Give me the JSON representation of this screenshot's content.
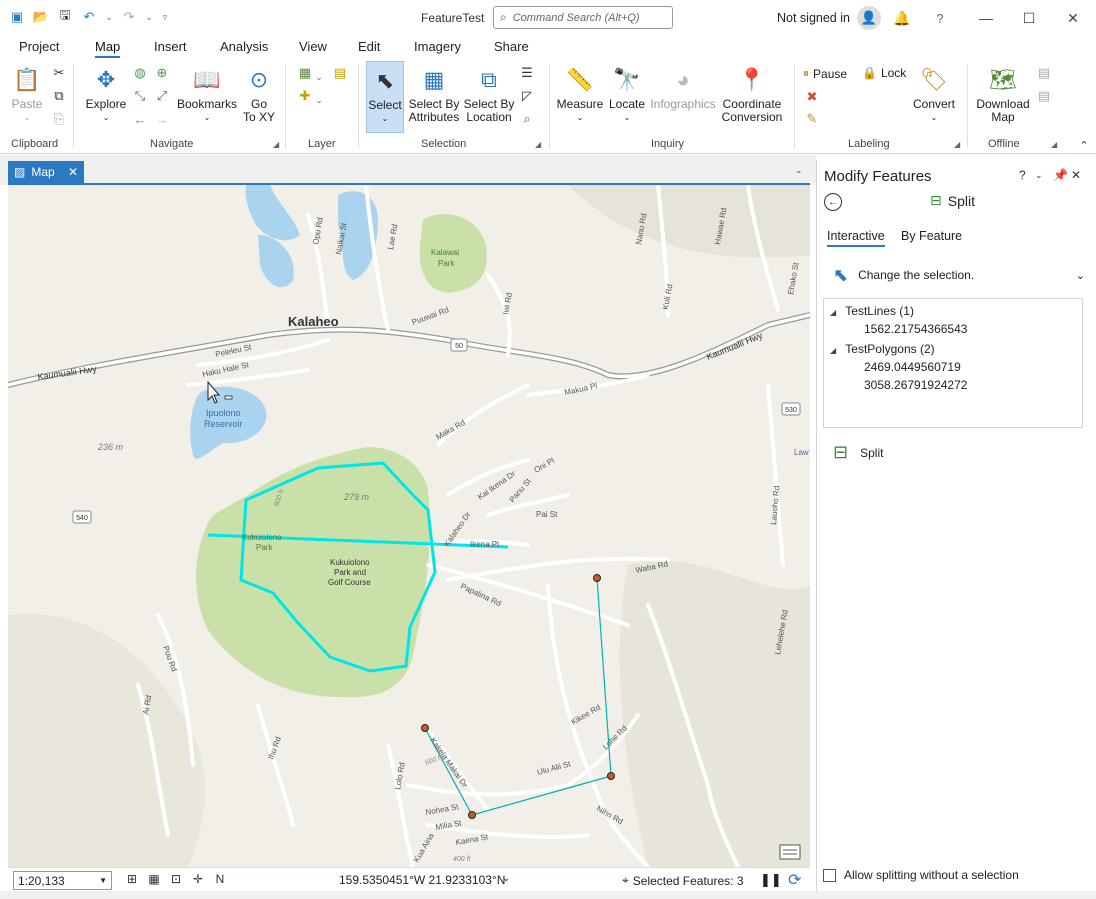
{
  "title_bar": {
    "app_title": "FeatureTest",
    "search_placeholder": "Command Search (Alt+Q)",
    "signed_in": "Not signed in"
  },
  "ribbon_tabs": [
    "Project",
    "Map",
    "Insert",
    "Analysis",
    "View",
    "Edit",
    "Imagery",
    "Share"
  ],
  "ribbon": {
    "clipboard": {
      "paste": "Paste",
      "group": "Clipboard"
    },
    "navigate": {
      "explore": "Explore",
      "bookmarks": "Bookmarks",
      "goto_1": "Go",
      "goto_2": "To XY",
      "group": "Navigate"
    },
    "layer": {
      "group": "Layer"
    },
    "selection": {
      "select": "Select",
      "by_attr_1": "Select By",
      "by_attr_2": "Attributes",
      "by_loc_1": "Select By",
      "by_loc_2": "Location",
      "group": "Selection"
    },
    "inquiry": {
      "measure": "Measure",
      "locate": "Locate",
      "infographics": "Infographics",
      "coord_1": "Coordinate",
      "coord_2": "Conversion",
      "group": "Inquiry"
    },
    "labeling": {
      "pause": "Pause",
      "lock": "Lock",
      "convert": "Convert",
      "group": "Labeling"
    },
    "offline": {
      "download_1": "Download",
      "download_2": "Map",
      "group": "Offline"
    }
  },
  "map_tab": {
    "label": "Map"
  },
  "map_labels": {
    "town": "Kalaheo",
    "kalawai_1": "Kalawai",
    "kalawai_2": "Park",
    "reservoir_1": "Ipuolono",
    "reservoir_2": "Reservoir",
    "golf_1": "Kukuiolono",
    "golf_2": "Park and",
    "golf_3": "Golf Course",
    "park_left": "Kukuiolono",
    "park_left_2": "Park",
    "elev_236": "236 m",
    "elev_279": "279 m",
    "elev_800": "800 ft",
    "elev_600": "600 ft",
    "elev_400": "400 ft",
    "hwy_left": "Kaumualii Hwy",
    "hwy_right": "Kaumualii Hwy",
    "shield_50": "50",
    "shield_540": "540",
    "shield_530": "530",
    "roads": {
      "opu": "Opu Rd",
      "naikai": "Naikai St",
      "lae": "Lae Rd",
      "puuwai": "Puuwai Rd",
      "iwi": "Iwi Rd",
      "kuli": "Kuli Rd",
      "nanu": "Nanu Rd",
      "hawae": "Hawae Rd",
      "ehako": "Ehako St",
      "peleleu": "Peleleu St",
      "haku": "Haku Hale St",
      "makua": "Makua Pl",
      "maka": "Maka Rd",
      "oni": "Oni Pl",
      "kaiikena": "Kai Ikena Dr",
      "panu": "Panu St",
      "pai": "Pai St",
      "ikena": "Ikena Pl",
      "pualoke": "Kalaheo Dr",
      "waha": "Waha Rd",
      "papalina": "Papalina Rd",
      "puu": "Puu Rd",
      "ai": "Ai Rd",
      "ihu": "Ihu Rd",
      "kikee": "Kikee Rd",
      "lohe": "Lohe Rd",
      "ulu": "Ulu Alii St",
      "kakela": "Kakela Makai Dr",
      "lolo": "Lolo Rd",
      "nohea": "Nohea St",
      "milia": "Milia St",
      "kaena": "Kaena St",
      "kua": "Kua Aina",
      "niho": "Niho Rd",
      "lauoho": "Lauoho Rd",
      "lehelehe": "Lehelehe Rd",
      "lau": "Law"
    }
  },
  "status_bar": {
    "scale": "1:20,133",
    "coordinates": "159.5350451°W 21.9233103°N",
    "selected": "Selected Features: 3"
  },
  "modify_pane": {
    "title": "Modify Features",
    "tool": "Split",
    "tabs": [
      "Interactive",
      "By Feature"
    ],
    "change_selection": "Change the selection.",
    "tree": [
      {
        "layer": "TestLines (1)",
        "items": [
          "1562.21754366543"
        ]
      },
      {
        "layer": "TestPolygons (2)",
        "items": [
          "2469.0449560719",
          "3058.26791924272"
        ]
      }
    ],
    "split_button": "Split",
    "allow_label": "Allow splitting without a selection"
  },
  "colors": {
    "accent": "#2b79c2",
    "selection": "#00e5e5",
    "park": "#c9e1a9",
    "water": "#a9d3ee"
  }
}
